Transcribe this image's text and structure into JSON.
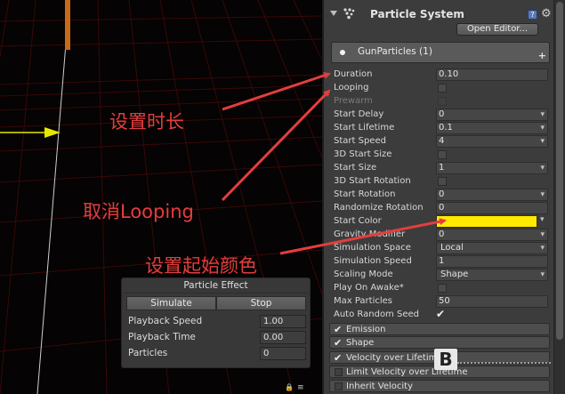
{
  "particle_effect": {
    "title": "Particle Effect",
    "simulate_label": "Simulate",
    "stop_label": "Stop",
    "playback_speed_label": "Playback Speed",
    "playback_speed_value": "1.00",
    "playback_time_label": "Playback Time",
    "playback_time_value": "0.00",
    "particles_label": "Particles",
    "particles_value": "0"
  },
  "inspector": {
    "component_title": "Particle System",
    "open_editor_label": "Open Editor...",
    "particle_name": "GunParticles (1)",
    "help_icon_glyph": "?",
    "gear_icon_glyph": "⚙",
    "plus_glyph": "+",
    "properties": {
      "duration": {
        "label": "Duration",
        "value": "0.10"
      },
      "looping": {
        "label": "Looping"
      },
      "prewarm": {
        "label": "Prewarm"
      },
      "start_delay": {
        "label": "Start Delay",
        "value": "0"
      },
      "start_lifetime": {
        "label": "Start Lifetime",
        "value": "0.1"
      },
      "start_speed": {
        "label": "Start Speed",
        "value": "4"
      },
      "start_size_3d": {
        "label": "3D Start Size"
      },
      "start_size": {
        "label": "Start Size",
        "value": "1"
      },
      "start_rotation_3d": {
        "label": "3D Start Rotation"
      },
      "start_rotation": {
        "label": "Start Rotation",
        "value": "0"
      },
      "randomize_rotation": {
        "label": "Randomize Rotation",
        "value": "0"
      },
      "start_color": {
        "label": "Start Color",
        "color": "#ffea00"
      },
      "gravity_modifier": {
        "label": "Gravity Modifier",
        "value": "0"
      },
      "simulation_space": {
        "label": "Simulation Space",
        "value": "Local"
      },
      "simulation_speed": {
        "label": "Simulation Speed",
        "value": "1"
      },
      "scaling_mode": {
        "label": "Scaling Mode",
        "value": "Shape"
      },
      "play_on_awake": {
        "label": "Play On Awake*"
      },
      "max_particles": {
        "label": "Max Particles",
        "value": "50"
      },
      "auto_random_seed": {
        "label": "Auto Random Seed"
      }
    },
    "modules": [
      {
        "label": "Emission",
        "checked": true
      },
      {
        "label": "Shape",
        "checked": true
      },
      {
        "label": "Velocity over Lifetime",
        "checked": true
      },
      {
        "label": "Limit Velocity over Lifetime",
        "checked": false
      },
      {
        "label": "Inherit Velocity",
        "checked": false
      }
    ],
    "watermark_letter": "B"
  },
  "annotations": {
    "set_duration": "设置时长",
    "cancel_looping": "取消Looping",
    "set_start_color": "设置起始颜色"
  },
  "scene": {
    "toolbar_lock_glyph": "🔒",
    "toolbar_menu_glyph": "≡"
  },
  "colors": {
    "annotation_red": "#e33e3e",
    "start_color": "#ffea00",
    "gizmo_yellow": "#e6e600",
    "grid_red": "#3a0808"
  }
}
